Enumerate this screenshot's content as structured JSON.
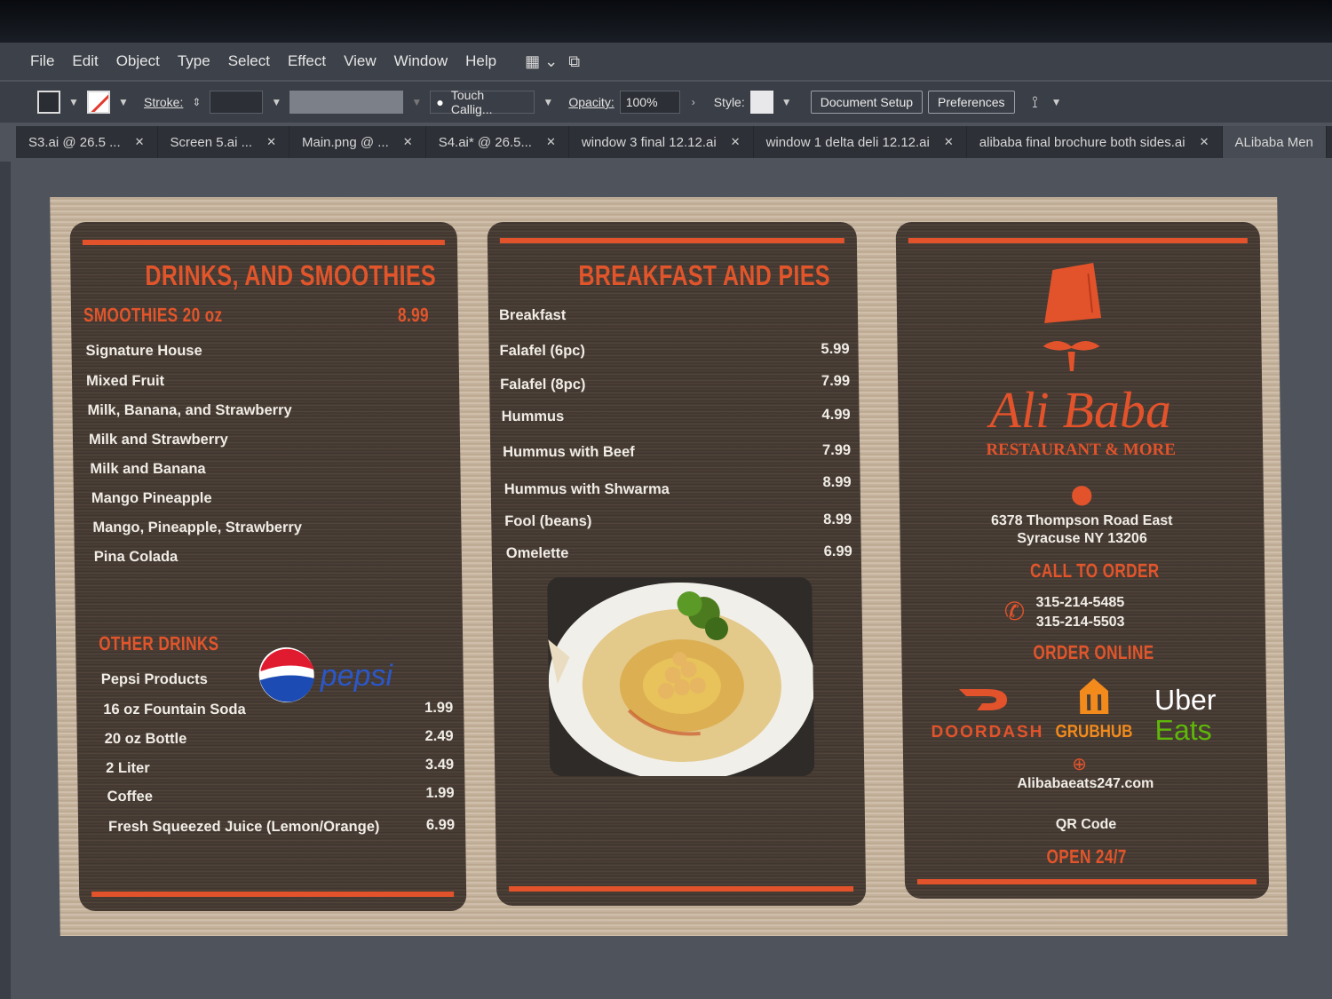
{
  "menubar": {
    "items": [
      "File",
      "Edit",
      "Object",
      "Type",
      "Select",
      "Effect",
      "View",
      "Window",
      "Help"
    ]
  },
  "controlbar": {
    "stroke_label": "Stroke:",
    "brush_name": "Touch Callig...",
    "opacity_label": "Opacity:",
    "opacity_value": "100%",
    "style_label": "Style:",
    "doc_setup": "Document Setup",
    "preferences": "Preferences"
  },
  "tabs": [
    {
      "label": "S3.ai @ 26.5 ..."
    },
    {
      "label": "Screen 5.ai ..."
    },
    {
      "label": "Main.png @ ..."
    },
    {
      "label": "S4.ai* @ 26.5..."
    },
    {
      "label": "window 3 final 12.12.ai"
    },
    {
      "label": "window 1 delta deli 12.12.ai"
    },
    {
      "label": "alibaba final brochure both sides.ai"
    },
    {
      "label": "ALibaba Men"
    }
  ],
  "left_panel": {
    "title": "DRINKS, AND SMOOTHIES",
    "smoothie_header": "SMOOTHIES 20 oz",
    "smoothie_price": "8.99",
    "smoothies": [
      "Signature House",
      "Mixed Fruit",
      "Milk, Banana, and Strawberry",
      "Milk and Strawberry",
      "Milk and Banana",
      "Mango Pineapple",
      "Mango, Pineapple, Strawberry",
      "Pina Colada"
    ],
    "other_header": "OTHER DRINKS",
    "pepsi_products": "Pepsi Products",
    "pepsi_logo": "pepsi",
    "drinks": [
      {
        "name": "16 oz Fountain Soda",
        "price": "1.99"
      },
      {
        "name": "20 oz Bottle",
        "price": "2.49"
      },
      {
        "name": "2 Liter",
        "price": "3.49"
      },
      {
        "name": "Coffee",
        "price": "1.99"
      },
      {
        "name": "Fresh Squeezed Juice (Lemon/Orange)",
        "price": "6.99"
      }
    ]
  },
  "middle_panel": {
    "title": "BREAKFAST AND PIES",
    "section": "Breakfast",
    "items": [
      {
        "name": "Falafel (6pc)",
        "price": "5.99"
      },
      {
        "name": "Falafel (8pc)",
        "price": "7.99"
      },
      {
        "name": "Hummus",
        "price": "4.99"
      },
      {
        "name": "Hummus with Beef",
        "price": "7.99"
      },
      {
        "name": "Hummus with Shwarma",
        "price": "8.99"
      },
      {
        "name": "Fool (beans)",
        "price": "8.99"
      },
      {
        "name": "Omelette",
        "price": "6.99"
      }
    ]
  },
  "right_panel": {
    "brand": "Ali Baba",
    "tagline": "RESTAURANT & MORE",
    "address_line1": "6378 Thompson Road East",
    "address_line2": "Syracuse NY 13206",
    "call_header": "CALL TO ORDER",
    "phone1": "315-214-5485",
    "phone2": "315-214-5503",
    "order_header": "ORDER ONLINE",
    "doordash": "DOORDASH",
    "grubhub": "GRUBHUB",
    "uber": "Uber",
    "eats": "Eats",
    "website": "Alibabaeats247.com",
    "qr": "QR Code",
    "open": "OPEN 24/7"
  },
  "colors": {
    "accent": "#e2532b",
    "uber_green": "#5fb709"
  }
}
